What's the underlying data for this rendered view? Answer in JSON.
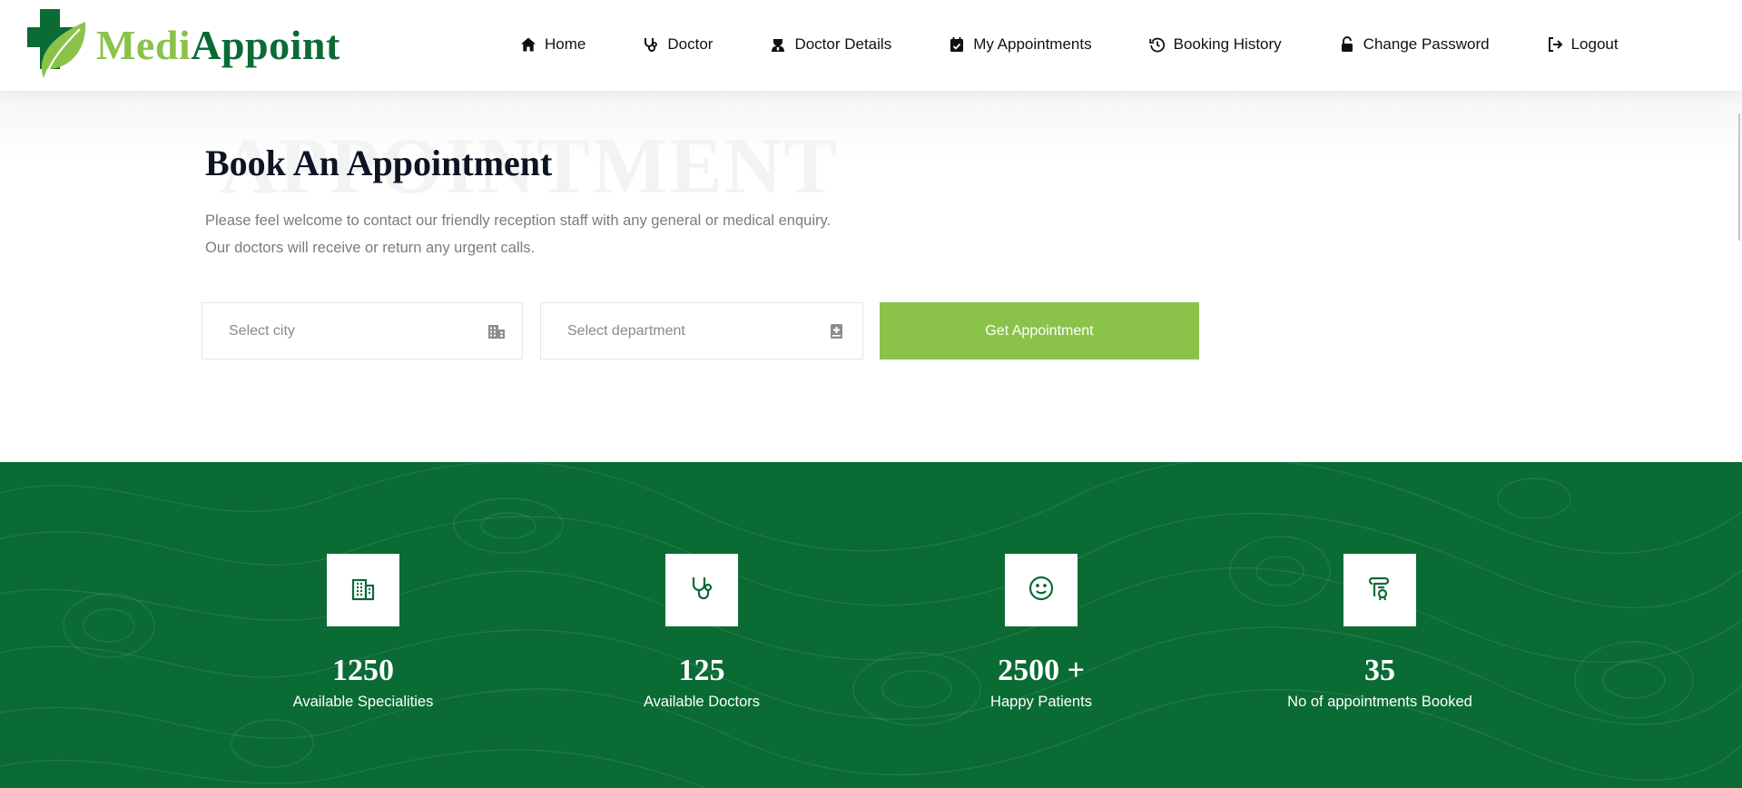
{
  "brand": {
    "part1": "Medi",
    "part2": "Appoint",
    "primary_color": "#0a6b35",
    "accent_color": "#8bc34a"
  },
  "nav": [
    {
      "label": "Home",
      "icon": "home-icon"
    },
    {
      "label": "Doctor",
      "icon": "stethoscope-icon"
    },
    {
      "label": "Doctor Details",
      "icon": "doctor-icon"
    },
    {
      "label": "My Appointments",
      "icon": "calendar-check-icon"
    },
    {
      "label": "Booking History",
      "icon": "history-icon"
    },
    {
      "label": "Change Password",
      "icon": "unlock-icon"
    },
    {
      "label": "Logout",
      "icon": "logout-icon"
    }
  ],
  "hero": {
    "watermark": "APPOINTMENT",
    "title": "Book An Appointment",
    "description": "Please feel welcome to contact our friendly reception staff with any general or medical enquiry. Our doctors will receive or return any urgent calls.",
    "city_placeholder": "Select city",
    "department_placeholder": "Select department",
    "button_label": "Get Appointment"
  },
  "stats": [
    {
      "value": "1250",
      "label": "Available Specialities",
      "icon": "building-icon"
    },
    {
      "value": "125",
      "label": "Available Doctors",
      "icon": "stethoscope-icon"
    },
    {
      "value": "2500 +",
      "label": "Happy Patients",
      "icon": "smile-icon"
    },
    {
      "value": "35",
      "label": "No of appointments Booked",
      "icon": "scroll-icon"
    }
  ]
}
